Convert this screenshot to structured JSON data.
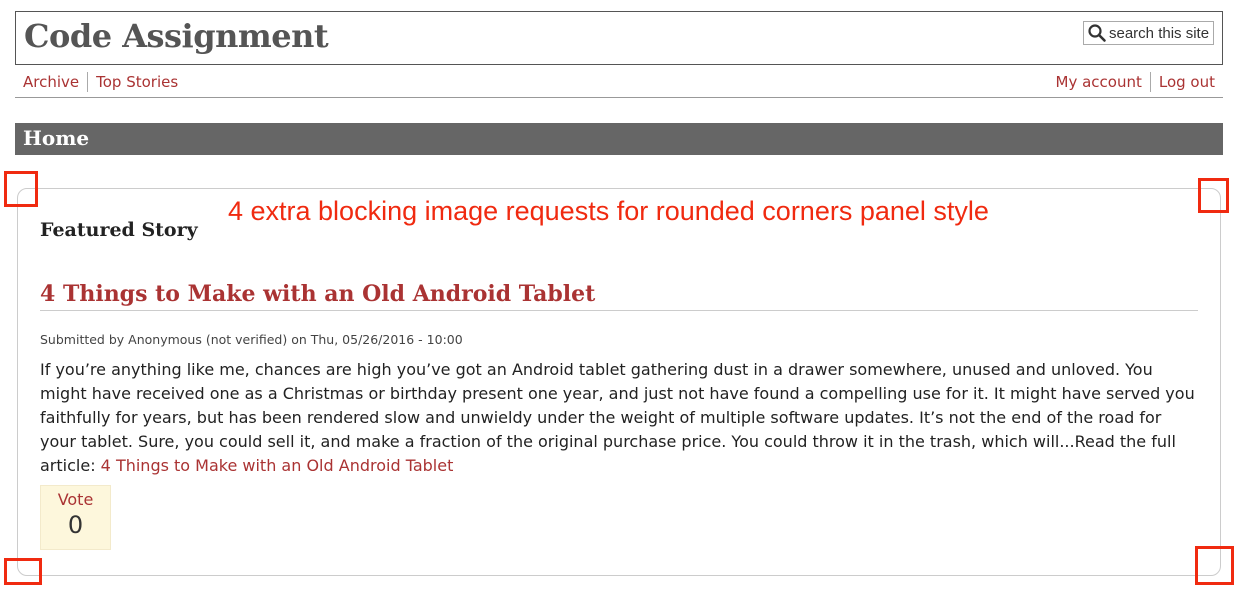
{
  "site": {
    "title": "Code Assignment",
    "search_placeholder": "search this site"
  },
  "nav": {
    "left": [
      "Archive",
      "Top Stories"
    ],
    "right": [
      "My account",
      "Log out"
    ]
  },
  "page": {
    "title": "Home"
  },
  "annotation": {
    "text": "4 extra blocking image requests for rounded corners panel style",
    "color": "#f02a10"
  },
  "featured": {
    "heading": "Featured Story",
    "story_title": "4 Things to Make with an Old Android Tablet",
    "submitted": "Submitted by Anonymous (not verified) on Thu, 05/26/2016 - 10:00",
    "body": "If you’re anything like me, chances are high you’ve got an Android tablet gathering dust in a drawer somewhere, unused and unloved. You might have received one as a Christmas or birthday present one year, and just not have found a compelling use for it. It might have served you faithfully for years, but has been rendered slow and unwieldy under the weight of multiple software updates. It’s not the end of the road for your tablet. Sure, you could sell it, and make a fraction of the original purchase price. You could throw it in the trash, which will...Read the full article: ",
    "link_text": "4 Things to Make with an Old Android Tablet"
  },
  "vote": {
    "label": "Vote",
    "count": "0"
  },
  "colors": {
    "link": "#a33",
    "home_bar": "#666",
    "vote_bg": "#fdf7dc"
  }
}
